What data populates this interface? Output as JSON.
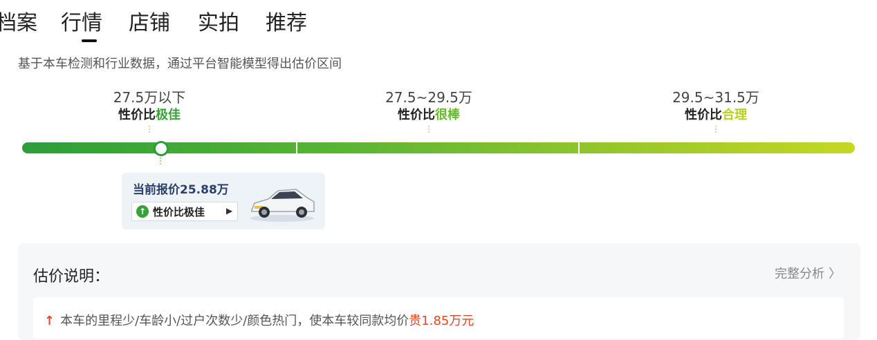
{
  "tabs": [
    "档案",
    "行情",
    "店铺",
    "实拍",
    "推荐"
  ],
  "active_tab": "行情",
  "description": "基于本车检测和行业数据，通过平台智能模型得出估价区间",
  "segments": [
    {
      "range": "27.5万以下",
      "prefix": "性价比",
      "level": "极佳",
      "color": "#38a235"
    },
    {
      "range": "27.5~29.5万",
      "prefix": "性价比",
      "level": "很棒",
      "color": "#66bb2a"
    },
    {
      "range": "29.5~31.5万",
      "prefix": "性价比",
      "level": "合理",
      "color": "#b8d21a"
    }
  ],
  "current": {
    "label": "当前报价",
    "price": "25.88万",
    "badge": "性价比极佳",
    "badge_icon": "up-arrow-icon",
    "car_icon": "car-thumbnail"
  },
  "explanation": {
    "title": "估价说明：",
    "link": "完整分析",
    "reason_icon": "↑",
    "reason_prefix": "本车的里程少/车龄小/过户次数少/颜色热门，使本车较同款均价",
    "reason_emph": "贵1.85万元"
  }
}
